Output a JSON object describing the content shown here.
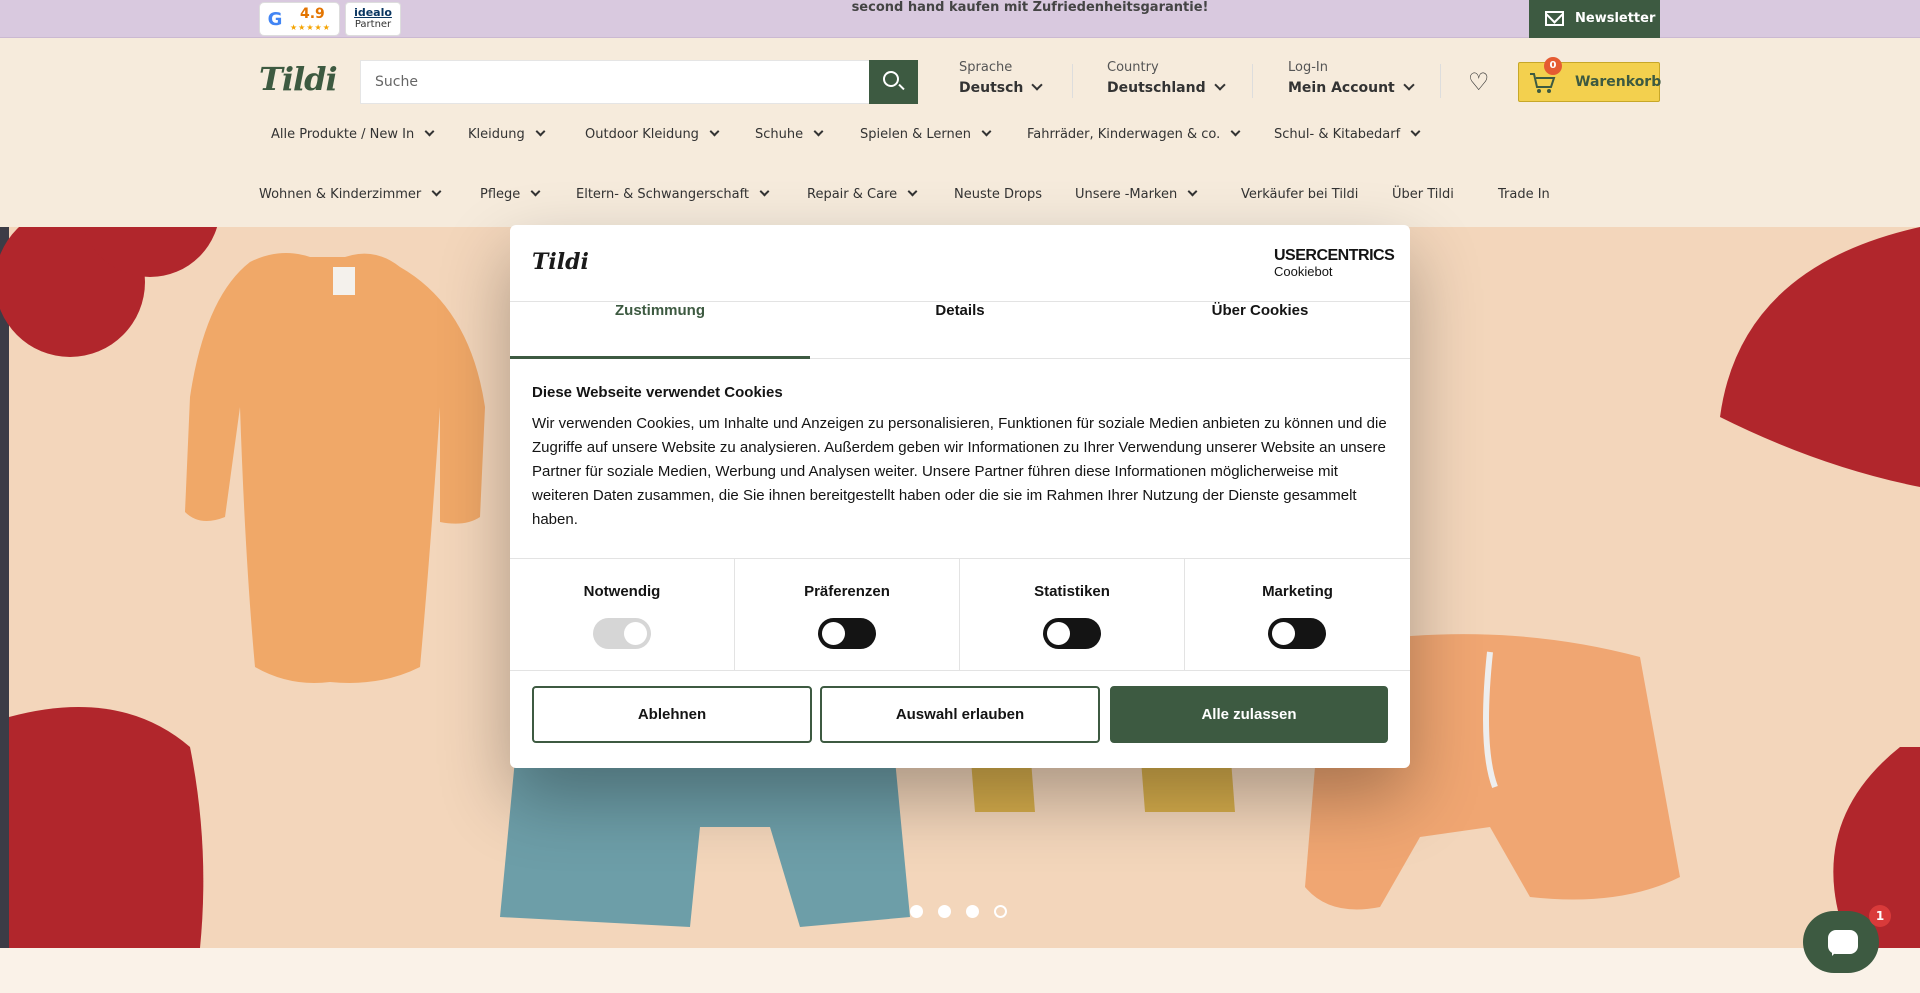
{
  "topbar": {
    "google_rating": "4.9",
    "google_stars": "★★★★★",
    "idealo_name": "idealo",
    "idealo_sub": "Partner",
    "promo": "second hand kaufen mit Zufriedenheitsgarantie!",
    "newsletter": "Newsletter"
  },
  "header": {
    "logo": "Tildi",
    "search_placeholder": "Suche",
    "language": {
      "caption": "Sprache",
      "value": "Deutsch"
    },
    "country": {
      "caption": "Country",
      "value": "Deutschland"
    },
    "account": {
      "caption": "Log-In",
      "value": "Mein Account"
    },
    "cart": {
      "count": "0",
      "label": "Warenkorb"
    }
  },
  "nav": {
    "row1": [
      {
        "label": "Alle Produkte / New In"
      },
      {
        "label": "Kleidung"
      },
      {
        "label": "Outdoor Kleidung"
      },
      {
        "label": "Schuhe"
      },
      {
        "label": "Spielen & Lernen"
      },
      {
        "label": "Fahrräder, Kinderwagen & co."
      },
      {
        "label": "Schul- & Kitabedarf"
      }
    ],
    "row2": [
      {
        "label": "Wohnen & Kinderzimmer"
      },
      {
        "label": "Pflege"
      },
      {
        "label": "Eltern- & Schwangerschaft"
      },
      {
        "label": "Repair & Care"
      },
      {
        "label": "Neuste Drops"
      },
      {
        "label": "Unsere  -Marken"
      },
      {
        "label": "Verkäufer bei Tildi"
      },
      {
        "label": "Über Tildi"
      },
      {
        "label": "Trade In"
      }
    ]
  },
  "hero": {
    "slide_count": 4,
    "active_slide": 4
  },
  "cookie": {
    "logo": "Tildi",
    "provider": "USERCENTRICS",
    "provider_sub": "Cookiebot",
    "tabs": [
      "Zustimmung",
      "Details",
      "Über Cookies"
    ],
    "title": "Diese Webseite verwendet Cookies",
    "text": "Wir verwenden Cookies, um Inhalte und Anzeigen zu personalisieren, Funktionen für soziale Medien anbieten zu können und die Zugriffe auf unsere Website zu analysieren. Außerdem geben wir Informationen zu Ihrer Verwendung unserer Website an unsere Partner für soziale Medien, Werbung und Analysen weiter. Unsere Partner führen diese Informationen möglicherweise mit weiteren Daten zusammen, die Sie ihnen bereitgestellt haben oder die sie im Rahmen Ihrer Nutzung der Dienste gesammelt haben.",
    "categories": [
      "Notwendig",
      "Präferenzen",
      "Statistiken",
      "Marketing"
    ],
    "buttons": {
      "decline": "Ablehnen",
      "allow_selection": "Auswahl erlauben",
      "allow_all": "Alle zulassen"
    }
  },
  "chat": {
    "unread": "1"
  }
}
